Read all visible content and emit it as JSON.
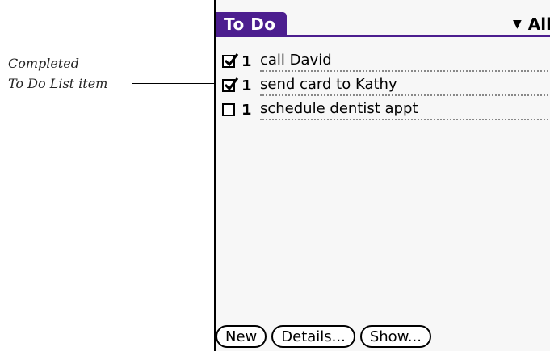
{
  "annotation": {
    "line1": "Completed",
    "line2": "To Do List item"
  },
  "app": {
    "title": "To Do",
    "category": "All",
    "accent_color": "#4c1e8f"
  },
  "items": [
    {
      "checked": true,
      "priority": "1",
      "description": "call David"
    },
    {
      "checked": true,
      "priority": "1",
      "description": "send card to Kathy"
    },
    {
      "checked": false,
      "priority": "1",
      "description": "schedule dentist appt"
    }
  ],
  "buttons": {
    "new": "New",
    "details": "Details...",
    "show": "Show..."
  }
}
